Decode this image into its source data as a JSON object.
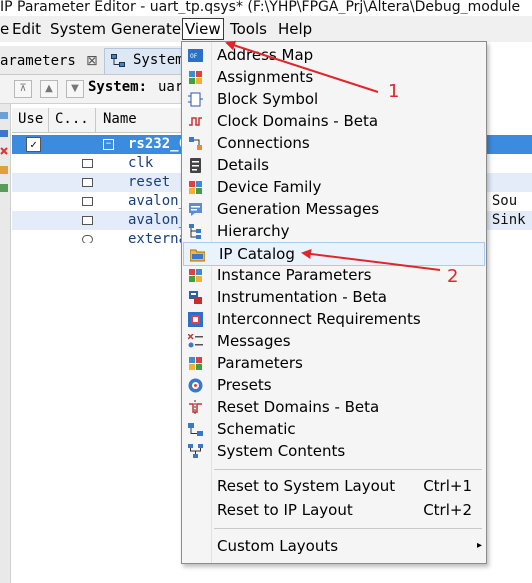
{
  "window": {
    "title": "IP Parameter Editor - uart_tp.qsys* (F:\\YHP\\FPGA_Prj\\Altera\\Debug_module"
  },
  "menubar": {
    "items": [
      "e",
      "Edit",
      "System",
      "Generate",
      "View",
      "Tools",
      "Help"
    ],
    "active": "View"
  },
  "tabs": {
    "parameters_label": "arameters",
    "close_glyph": "⊠",
    "system_label": "System"
  },
  "toolbar": {
    "system_label": "System:",
    "system_value": "uart"
  },
  "table": {
    "headers": [
      "Use",
      "C...",
      "Name"
    ],
    "rows": [
      {
        "name": "rs232_C",
        "selected": true,
        "checked": true
      },
      {
        "name": "clk",
        "right": ""
      },
      {
        "name": "reset",
        "right": ""
      },
      {
        "name": "avalon_",
        "right": "g Sou"
      },
      {
        "name": "avalon_",
        "right": "g Sink"
      },
      {
        "name": "externa",
        "right": ""
      }
    ]
  },
  "view_menu": {
    "items": [
      {
        "label": "Address Map",
        "icon": "address-map-icon"
      },
      {
        "label": "Assignments",
        "icon": "assignments-icon"
      },
      {
        "label": "Block Symbol",
        "icon": "block-symbol-icon"
      },
      {
        "label": "Clock Domains - Beta",
        "icon": "clock-domains-icon"
      },
      {
        "label": "Connections",
        "icon": "connections-icon"
      },
      {
        "label": "Details",
        "icon": "details-icon"
      },
      {
        "label": "Device Family",
        "icon": "device-family-icon"
      },
      {
        "label": "Generation Messages",
        "icon": "generation-messages-icon"
      },
      {
        "label": "Hierarchy",
        "icon": "hierarchy-icon"
      },
      {
        "label": "IP Catalog",
        "icon": "ip-catalog-icon",
        "highlighted": true
      },
      {
        "label": "Instance Parameters",
        "icon": "instance-parameters-icon"
      },
      {
        "label": "Instrumentation - Beta",
        "icon": "instrumentation-icon"
      },
      {
        "label": "Interconnect Requirements",
        "icon": "interconnect-icon"
      },
      {
        "label": "Messages",
        "icon": "messages-icon"
      },
      {
        "label": "Parameters",
        "icon": "parameters-icon"
      },
      {
        "label": "Presets",
        "icon": "presets-icon"
      },
      {
        "label": "Reset Domains - Beta",
        "icon": "reset-domains-icon"
      },
      {
        "label": "Schematic",
        "icon": "schematic-icon"
      },
      {
        "label": "System Contents",
        "icon": "system-contents-icon"
      }
    ],
    "layout_items": [
      {
        "label": "Reset to System Layout",
        "shortcut": "Ctrl+1"
      },
      {
        "label": "Reset to IP Layout",
        "shortcut": "Ctrl+2"
      }
    ],
    "custom_layouts": {
      "label": "Custom Layouts",
      "submenu_glyph": "▸"
    }
  },
  "annotations": {
    "arrow1_label": "1",
    "arrow2_label": "2",
    "color": "#e0262a"
  }
}
